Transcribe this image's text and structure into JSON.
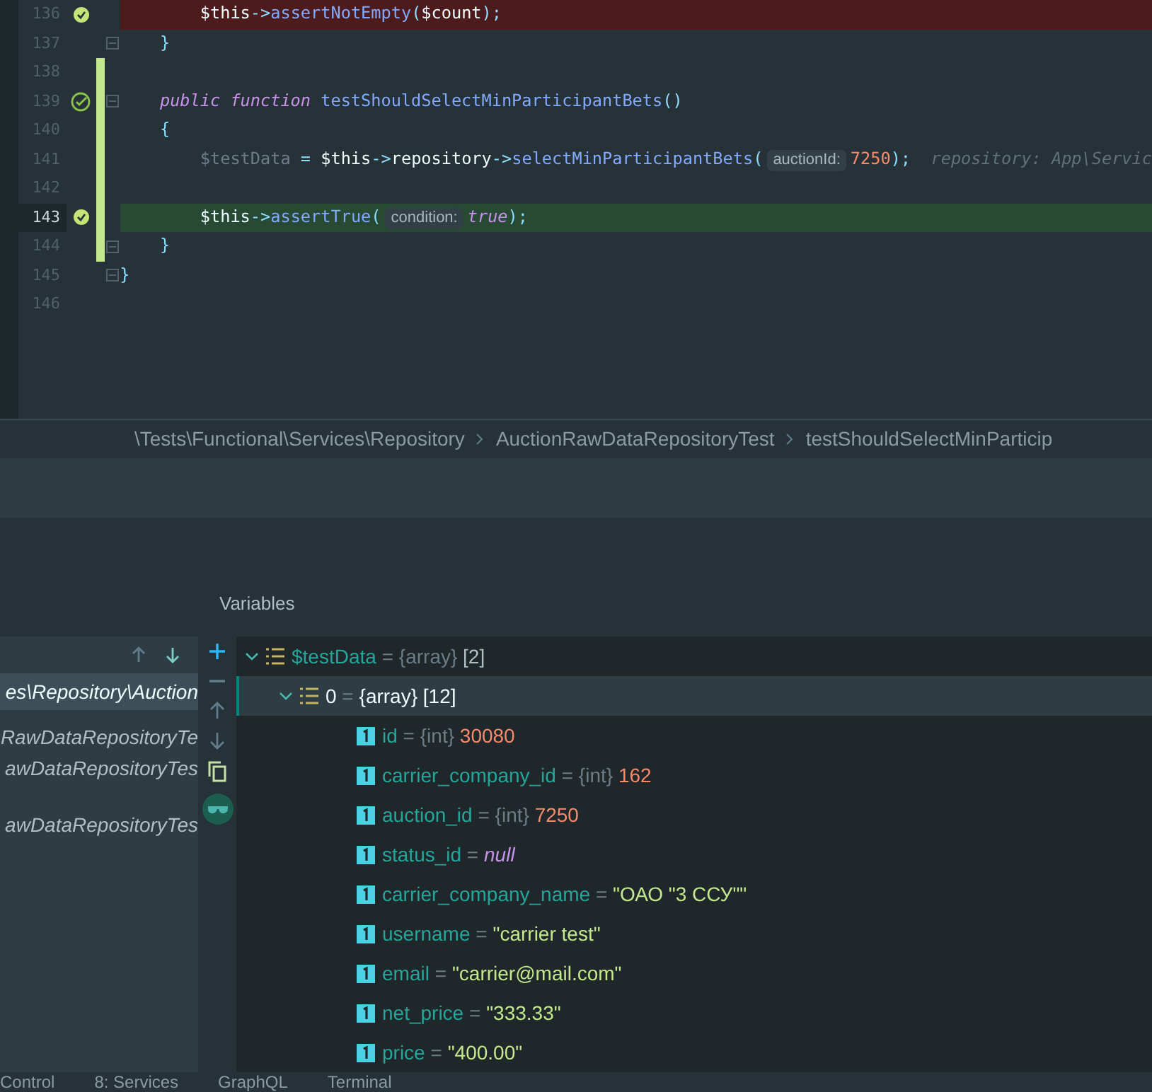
{
  "editor": {
    "lines": [
      {
        "number": "136",
        "error": true,
        "success": false,
        "changed": false,
        "test_icon": false,
        "check_icon": true,
        "fold": false,
        "current": false,
        "tokens": [
          {
            "text": "        $this",
            "kind": "this"
          },
          {
            "text": "->",
            "kind": "op"
          },
          {
            "text": "assertNotEmpty",
            "kind": "fn"
          },
          {
            "text": "(",
            "kind": "op"
          },
          {
            "text": "$count",
            "kind": "this"
          },
          {
            "text": ");",
            "kind": "op"
          }
        ]
      },
      {
        "number": "137",
        "error": false,
        "success": false,
        "changed": false,
        "test_icon": false,
        "check_icon": false,
        "fold": true,
        "current": false,
        "tokens": [
          {
            "text": "    }",
            "kind": "brace"
          }
        ]
      },
      {
        "number": "138",
        "error": false,
        "success": false,
        "changed": true,
        "test_icon": false,
        "check_icon": false,
        "fold": false,
        "current": false
      },
      {
        "number": "139",
        "error": false,
        "success": false,
        "changed": true,
        "test_icon": true,
        "check_icon": false,
        "fold": true,
        "current": false,
        "tokens": [
          {
            "text": "    public function",
            "kind": "keyword"
          },
          {
            "text": " testShouldSelectMinParticipantBets",
            "kind": "fn"
          },
          {
            "text": "()",
            "kind": "op"
          }
        ]
      },
      {
        "number": "140",
        "error": false,
        "success": false,
        "changed": true,
        "test_icon": false,
        "check_icon": false,
        "fold": false,
        "current": false,
        "tokens": [
          {
            "text": "    {",
            "kind": "brace"
          }
        ]
      },
      {
        "number": "141",
        "error": false,
        "success": false,
        "changed": true,
        "test_icon": false,
        "check_icon": false,
        "fold": false,
        "current": false,
        "tokens": [
          {
            "text": "        $testData",
            "kind": "var"
          },
          {
            "text": " = ",
            "kind": "op"
          },
          {
            "text": "$this",
            "kind": "this"
          },
          {
            "text": "->",
            "kind": "op"
          },
          {
            "text": "repository",
            "kind": "this"
          },
          {
            "text": "->",
            "kind": "op"
          },
          {
            "text": "selectMinParticipantBets",
            "kind": "fn"
          },
          {
            "text": "(",
            "kind": "op"
          },
          {
            "text": "auctionId:",
            "kind": "hint"
          },
          {
            "text": "7250",
            "kind": "number"
          },
          {
            "text": ");",
            "kind": "op"
          },
          {
            "text": "  repository: App\\Servic",
            "kind": "comment"
          }
        ]
      },
      {
        "number": "142",
        "error": false,
        "success": false,
        "changed": true,
        "test_icon": false,
        "check_icon": false,
        "fold": false,
        "current": false
      },
      {
        "number": "143",
        "error": false,
        "success": true,
        "changed": true,
        "test_icon": false,
        "check_icon": true,
        "fold": false,
        "current": true,
        "tokens": [
          {
            "text": "        $this",
            "kind": "this"
          },
          {
            "text": "->",
            "kind": "op"
          },
          {
            "text": "assertTrue",
            "kind": "fn"
          },
          {
            "text": "(",
            "kind": "op"
          },
          {
            "text": "condition:",
            "kind": "hint"
          },
          {
            "text": "true",
            "kind": "keyword"
          },
          {
            "text": ");",
            "kind": "op"
          }
        ]
      },
      {
        "number": "144",
        "error": false,
        "success": false,
        "changed": true,
        "test_icon": false,
        "check_icon": false,
        "fold": true,
        "current": false,
        "tokens": [
          {
            "text": "    }",
            "kind": "brace"
          }
        ]
      },
      {
        "number": "145",
        "error": false,
        "success": false,
        "changed": false,
        "test_icon": false,
        "check_icon": false,
        "fold": true,
        "current": false,
        "tokens": [
          {
            "text": "}",
            "kind": "brace"
          }
        ]
      },
      {
        "number": "146",
        "error": false,
        "success": false,
        "changed": false,
        "test_icon": false,
        "check_icon": false,
        "fold": false,
        "current": false
      }
    ]
  },
  "breadcrumbs": [
    "\\Tests\\Functional\\Services\\Repository",
    "AuctionRawDataRepositoryTest",
    "testShouldSelectMinParticip"
  ],
  "debugger": {
    "variables_title": "Variables",
    "frames": [
      {
        "label": "es\\Repository\\Auction",
        "selected": true
      },
      {
        "label": "RawDataRepositoryTe",
        "selected": false
      },
      {
        "label": "awDataRepositoryTes",
        "selected": false
      },
      {
        "label": "awDataRepositoryTes",
        "selected": false
      }
    ],
    "variables": [
      {
        "name": "$testData",
        "operator": "=",
        "type": "{array}",
        "value": "[2]",
        "kind": "array",
        "expanded": true,
        "selected": false,
        "children": [
          {
            "name": "0",
            "operator": "=",
            "type": "{array}",
            "value": "[12]",
            "kind": "array",
            "expanded": true,
            "selected": true,
            "children": [
              {
                "name": "id",
                "operator": "=",
                "type": "{int}",
                "value": "30080",
                "kind": "number"
              },
              {
                "name": "carrier_company_id",
                "operator": "=",
                "type": "{int}",
                "value": "162",
                "kind": "number"
              },
              {
                "name": "auction_id",
                "operator": "=",
                "type": "{int}",
                "value": "7250",
                "kind": "number"
              },
              {
                "name": "status_id",
                "operator": "=",
                "value": "null",
                "kind": "null"
              },
              {
                "name": "carrier_company_name",
                "operator": "=",
                "value": "\"ОАО \"3 ССУ\"\"",
                "kind": "string"
              },
              {
                "name": "username",
                "operator": "=",
                "value": "\"carrier test\"",
                "kind": "string"
              },
              {
                "name": "email",
                "operator": "=",
                "value": "\"carrier@mail.com\"",
                "kind": "string"
              },
              {
                "name": "net_price",
                "operator": "=",
                "value": "\"333.33\"",
                "kind": "string"
              },
              {
                "name": "price",
                "operator": "=",
                "value": "\"400.00\"",
                "kind": "string"
              }
            ]
          }
        ]
      }
    ]
  },
  "bottom_tabs": [
    "Control",
    "8: Services",
    "GraphQL",
    "Terminal"
  ]
}
